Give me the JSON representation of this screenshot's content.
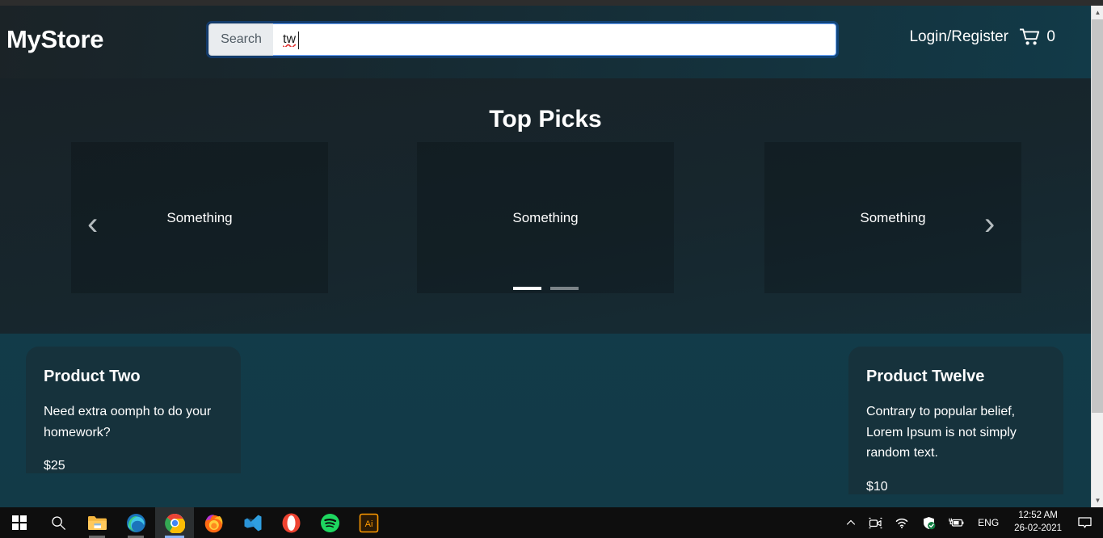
{
  "browser": {
    "scrollbar": {
      "up_arrow": "▲",
      "down_arrow": "▼"
    }
  },
  "header": {
    "brand": "MyStore",
    "search": {
      "prefix_label": "Search",
      "value": "tw",
      "placeholder": ""
    },
    "login_label": "Login/Register",
    "cart": {
      "icon": "cart-icon",
      "count": "0"
    }
  },
  "carousel": {
    "title": "Top Picks",
    "slides": [
      {
        "label": "Something"
      },
      {
        "label": "Something"
      },
      {
        "label": "Something"
      }
    ],
    "prev_glyph": "‹",
    "next_glyph": "›",
    "indicators": [
      {
        "active": true
      },
      {
        "active": false
      }
    ]
  },
  "products": [
    {
      "title": "Product Two",
      "description": "Need extra oomph to do your homework?",
      "price": "$25"
    },
    {
      "title": "Product Twelve",
      "description": "Contrary to popular belief, Lorem Ipsum is not simply random text.",
      "price": "$10"
    }
  ],
  "taskbar": {
    "apps": [
      {
        "name": "start-button"
      },
      {
        "name": "search-button"
      },
      {
        "name": "file-explorer"
      },
      {
        "name": "microsoft-edge"
      },
      {
        "name": "google-chrome"
      },
      {
        "name": "mozilla-firefox"
      },
      {
        "name": "visual-studio-code"
      },
      {
        "name": "opera"
      },
      {
        "name": "spotify"
      },
      {
        "name": "adobe-illustrator",
        "label": "Ai"
      }
    ],
    "tray": {
      "show_hidden_glyph": "⌃",
      "language": "ENG",
      "time": "12:52 AM",
      "date": "26-02-2021"
    }
  },
  "colors": {
    "page_bg_top": "#14242b",
    "page_bg_bottom": "#123a47",
    "card_bg": "#16323c",
    "accent_focus": "#6ea8fe",
    "taskbar_bg": "#0e0e0e"
  }
}
